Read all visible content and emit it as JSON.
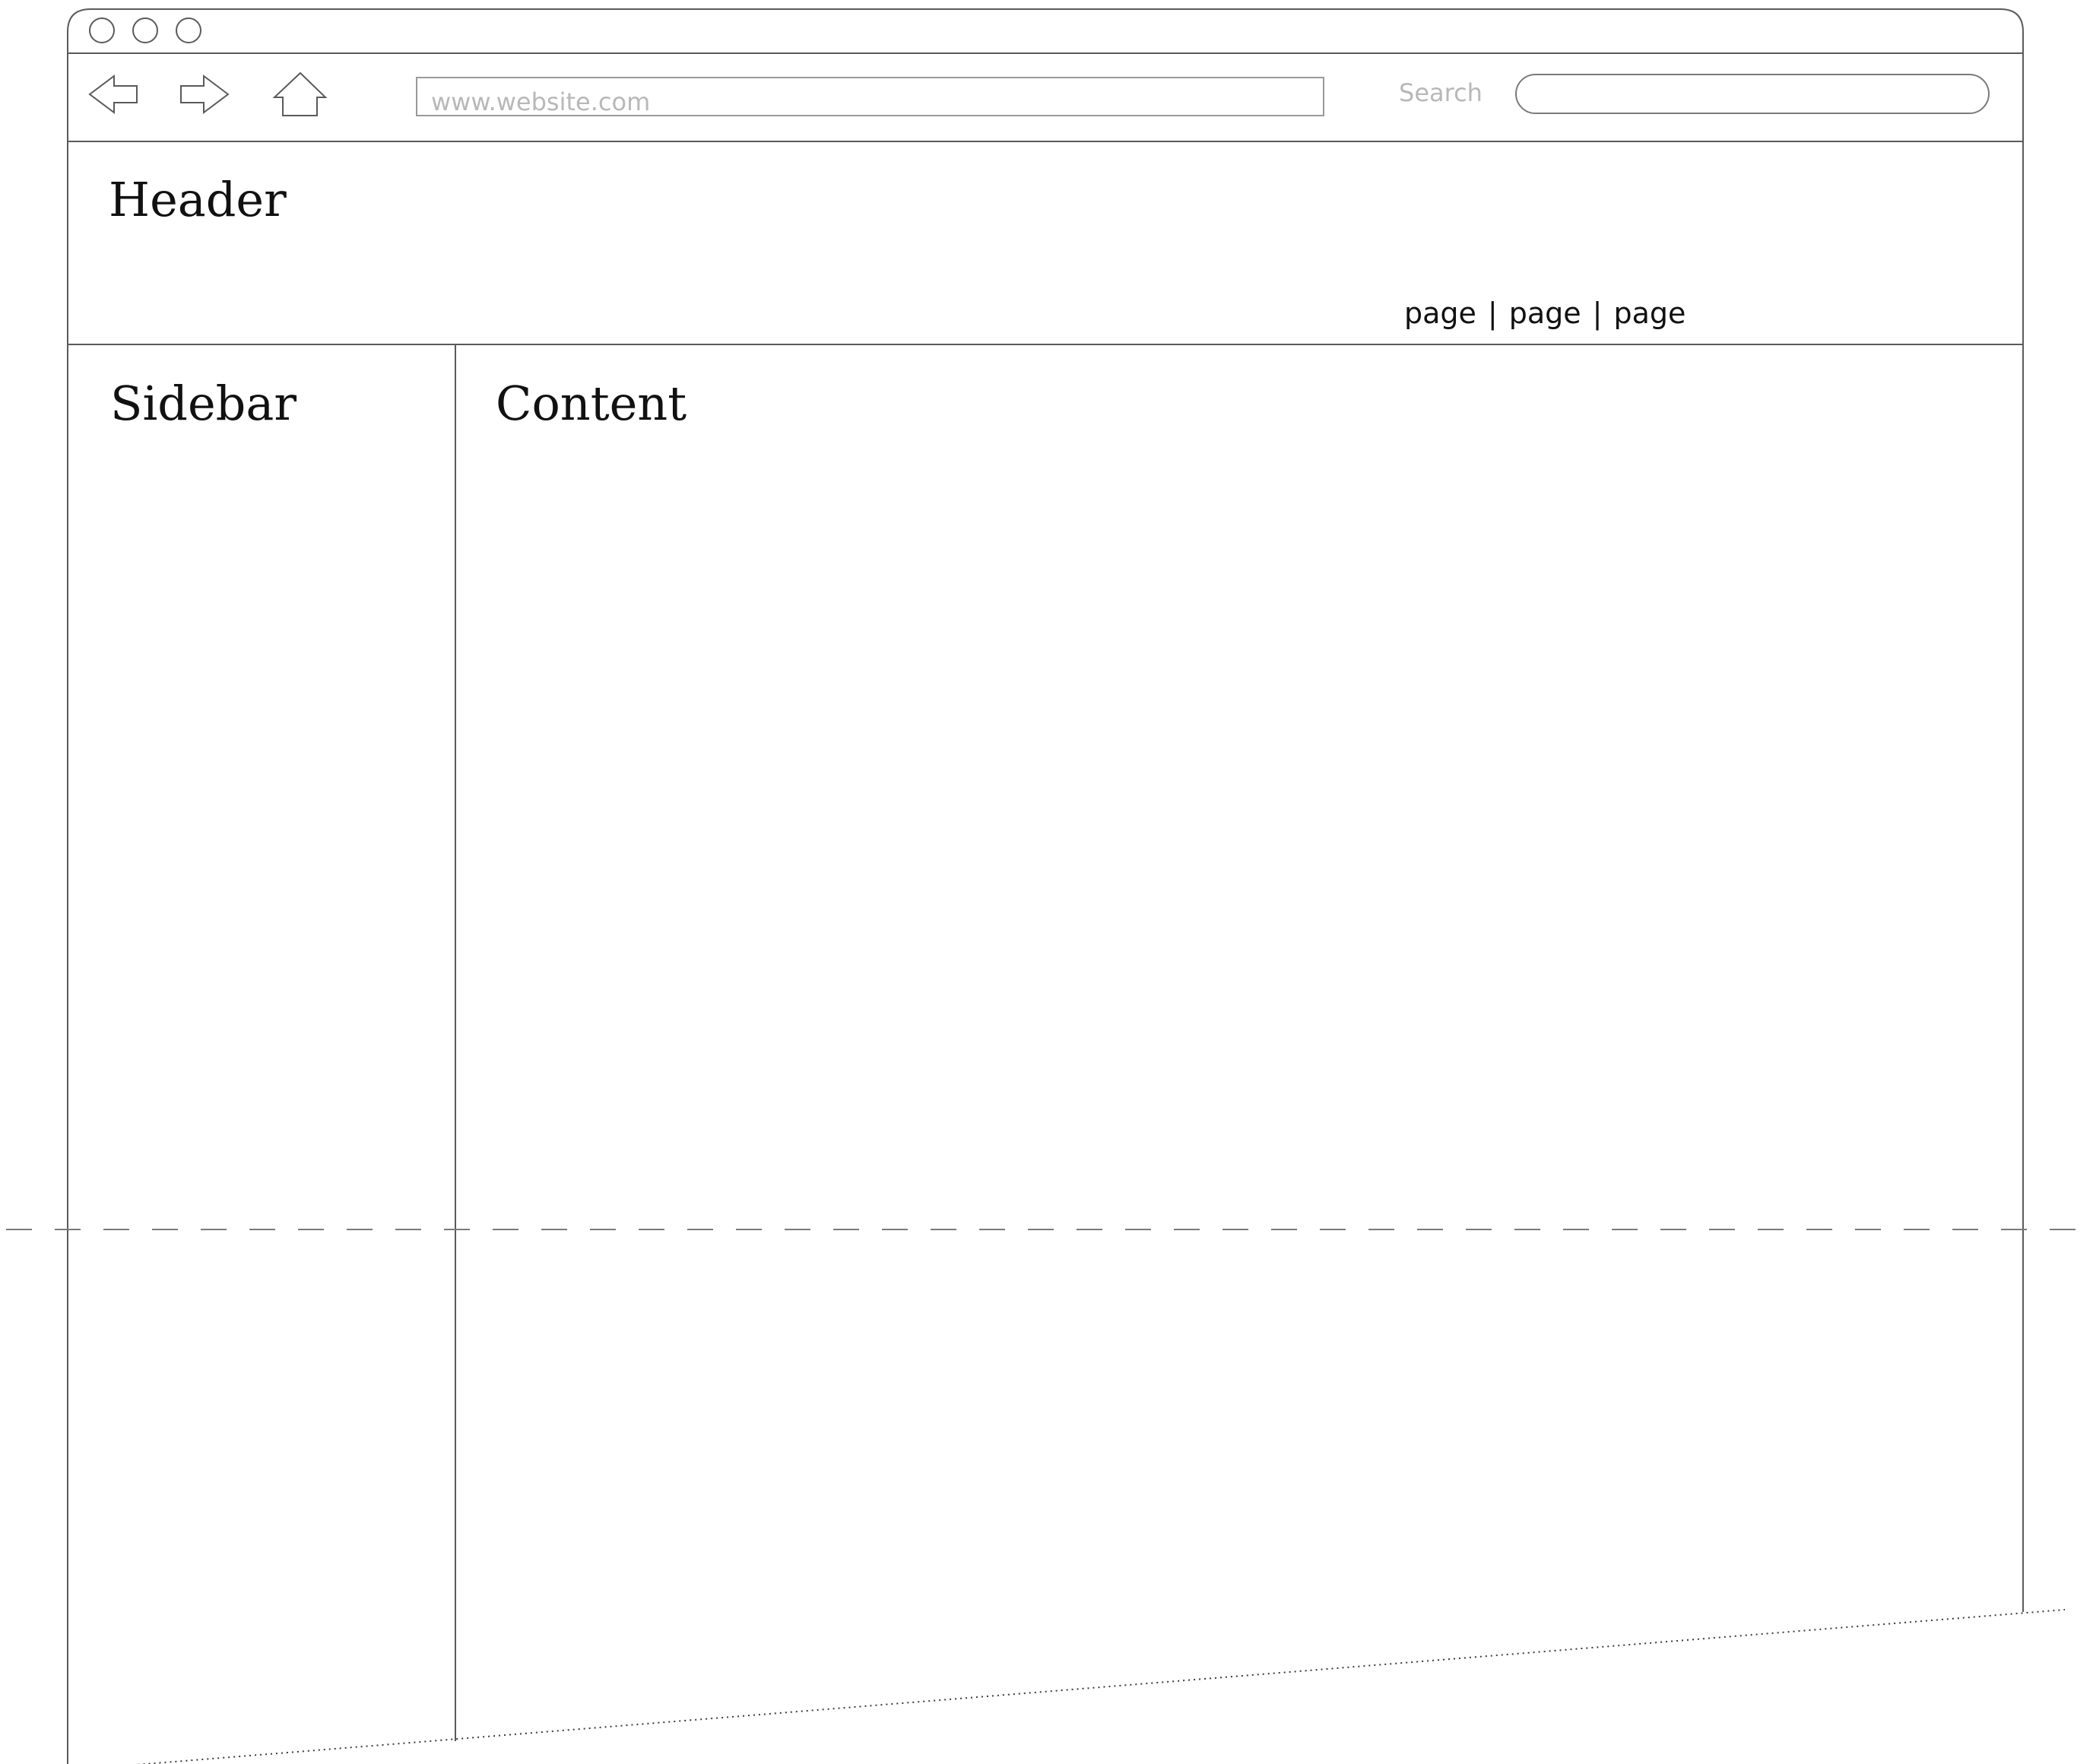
{
  "browser": {
    "window_buttons": [
      "close",
      "minimize",
      "maximize"
    ],
    "address_bar": {
      "placeholder": "www.website.com"
    },
    "search": {
      "label": "Search",
      "value": ""
    },
    "icons": [
      "back-arrow-icon",
      "forward-arrow-icon",
      "home-icon"
    ]
  },
  "header": {
    "title": "Header",
    "nav_links": [
      "page",
      "page",
      "page"
    ],
    "separator": "|"
  },
  "sidebar": {
    "title": "Sidebar"
  },
  "content": {
    "title": "Content"
  },
  "colors": {
    "outline": "#5a5a5a",
    "placeholder_text": "#b8b8b8",
    "text": "#111111",
    "fold_line": "#7a7a7a"
  }
}
